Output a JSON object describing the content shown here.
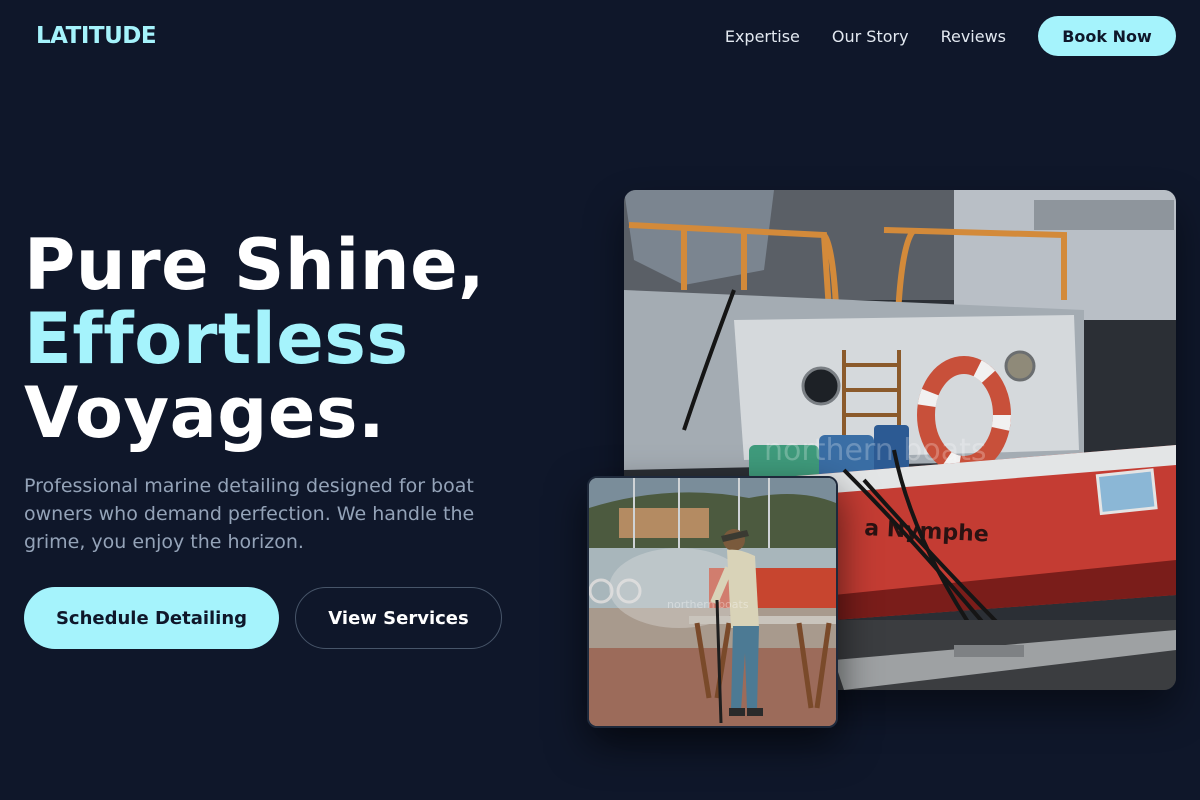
{
  "brand": {
    "logo": "LATITUDE"
  },
  "nav": {
    "links": [
      "Expertise",
      "Our Story",
      "Reviews"
    ],
    "cta": "Book Now"
  },
  "hero": {
    "title_line1": "Pure Shine,",
    "title_line2": "Effortless",
    "title_line3": "Voyages.",
    "description": "Professional marine detailing designed for boat owners who demand perfection. We handle the grime, you enjoy the horizon.",
    "primary_cta": "Schedule Detailing",
    "secondary_cta": "View Services"
  },
  "images": {
    "main": {
      "boat_name": "a Nymphe",
      "watermark": "northern boats"
    },
    "secondary": {
      "watermark": "northern boats"
    }
  },
  "colors": {
    "background": "#0f172a",
    "accent": "#a5f3fc",
    "muted_text": "#94a3b8"
  }
}
